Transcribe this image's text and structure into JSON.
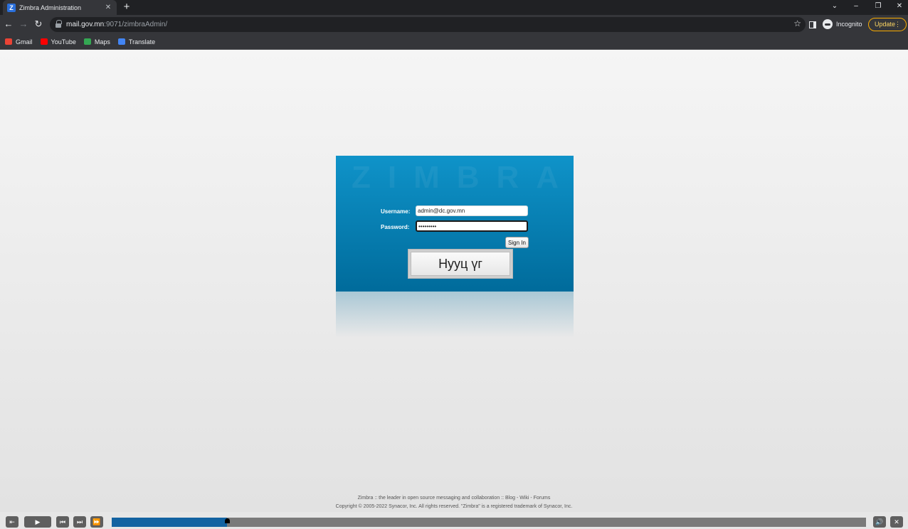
{
  "browser": {
    "tab_title": "Zimbra Administration",
    "tab_favicon_letter": "Z",
    "tab_close": "✕",
    "new_tab": "+",
    "url_host": "mail.gov.mn",
    "url_rest": ":9071/zimbraAdmin/",
    "incognito_label": "Incognito",
    "update_label": "Update",
    "update_dots": "⋮",
    "window_controls": {
      "dropdown": "⌄",
      "minimize": "–",
      "restore": "❐",
      "close": "✕"
    },
    "nav": {
      "back": "←",
      "forward": "→",
      "reload": "↻",
      "star": "☆"
    },
    "bookmarks": [
      {
        "label": "Gmail",
        "color": "#ea4335"
      },
      {
        "label": "YouTube",
        "color": "#ff0000"
      },
      {
        "label": "Maps",
        "color": "#34a853"
      },
      {
        "label": "Translate",
        "color": "#4285f4"
      }
    ]
  },
  "login": {
    "username_label": "Username:",
    "username_value": "admin@dc.gov.mn",
    "password_label": "Password:",
    "password_value": "•••••••••",
    "signin_label": "Sign In",
    "tooltip_text": "Нууц үг",
    "brand_color": "#0a87bd"
  },
  "footer": {
    "line1": "Zimbra :: the leader in open source messaging and collaboration :: Blog - Wiki - Forums",
    "line2": "Copyright © 2005-2022 Synacor, Inc. All rights reserved. \"Zimbra\" is a registered trademark of Synacor, Inc."
  },
  "player": {
    "progress_fraction": 0.153,
    "icons": {
      "exit": "⇤",
      "play": "▶",
      "prev": "⏮",
      "next": "⏭",
      "forward": "⏩",
      "volume": "🔊",
      "close": "✕"
    }
  }
}
